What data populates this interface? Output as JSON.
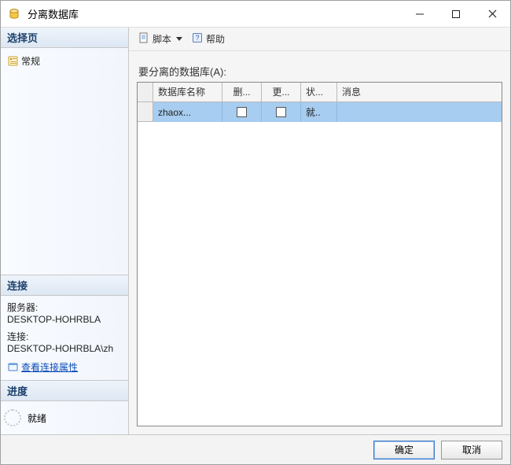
{
  "titlebar": {
    "title": "分离数据库"
  },
  "leftpane": {
    "select_page_header": "选择页",
    "general_item": "常规",
    "connection_header": "连接",
    "server_label": "服务器:",
    "server_value": "DESKTOP-HOHRBLA",
    "conn_label": "连接:",
    "conn_value": "DESKTOP-HOHRBLA\\zh",
    "view_conn_props": "查看连接属性",
    "progress_header": "进度",
    "progress_status": "就绪"
  },
  "toolbar": {
    "script_label": "脚本",
    "help_label": "帮助"
  },
  "main": {
    "grid_label": "要分离的数据库(A):",
    "columns": {
      "name": "数据库名称",
      "drop": "删...",
      "update": "更...",
      "state": "状...",
      "message": "消息"
    },
    "rows": [
      {
        "name": "zhaox...",
        "drop": false,
        "update": false,
        "state": "就..",
        "message": ""
      }
    ]
  },
  "footer": {
    "ok": "确定",
    "cancel": "取消"
  }
}
